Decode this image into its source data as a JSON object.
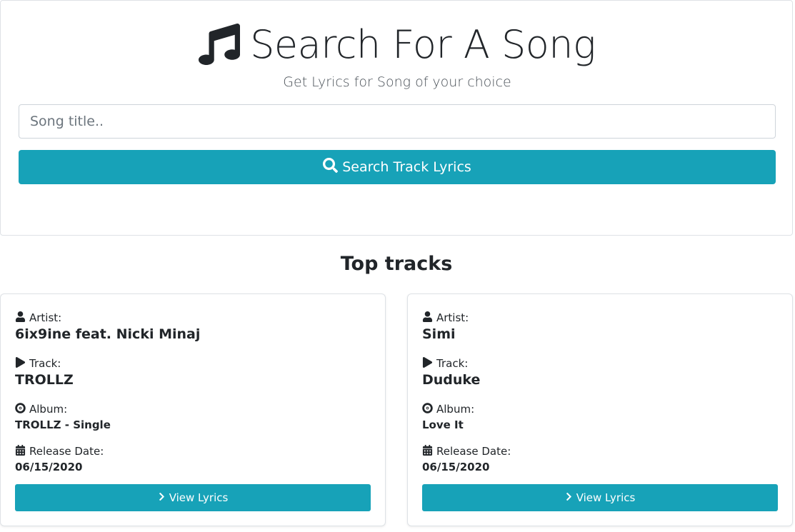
{
  "header": {
    "title": "Search For A Song",
    "subtitle": "Get Lyrics for Song of your choice",
    "title_icon": "music-note-icon"
  },
  "search": {
    "placeholder": "Song title..",
    "value": "",
    "button_label": "Search Track Lyrics",
    "button_icon": "search-icon"
  },
  "colors": {
    "accent": "#17a2b8",
    "text": "#212529",
    "border": "#dee2e6"
  },
  "top_tracks": {
    "heading": "Top tracks",
    "labels": {
      "artist": "Artist:",
      "track": "Track:",
      "album": "Album:",
      "release_date": "Release Date:",
      "view_button": "View Lyrics"
    },
    "icons": {
      "artist": "user-icon",
      "track": "play-icon",
      "album": "compact-disc-icon",
      "release_date": "calendar-icon",
      "view_button": "chevron-right-icon"
    },
    "items": [
      {
        "artist": "6ix9ine feat. Nicki Minaj",
        "track": "TROLLZ",
        "album": "TROLLZ - Single",
        "release_date": "06/15/2020"
      },
      {
        "artist": "Simi",
        "track": "Duduke",
        "album": "Love It",
        "release_date": "06/15/2020"
      }
    ]
  }
}
